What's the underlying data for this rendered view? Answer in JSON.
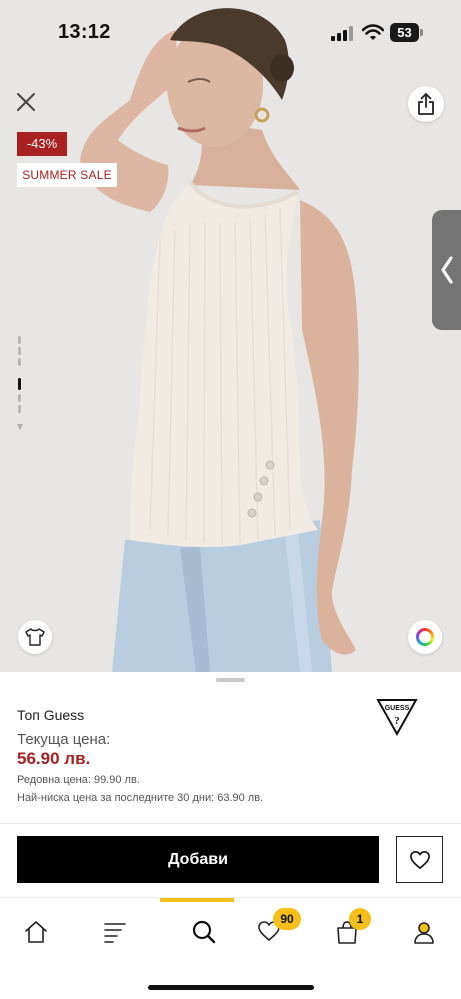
{
  "status_bar": {
    "time": "13:12",
    "battery": "53"
  },
  "gallery": {
    "discount_badge": "-43%",
    "sale_badge": "SUMMER SALE",
    "icons": {
      "close": "close-icon",
      "share": "share-icon",
      "back": "chevron-left-icon",
      "shirt": "tshirt-icon",
      "colors": "color-wheel-icon"
    }
  },
  "product": {
    "title": "Топ Guess",
    "brand_logo": "GUESS",
    "price_label": "Текуща цена:",
    "price": "56.90 лв.",
    "regular_price": "Редовна цена: 99.90 лв.",
    "lowest_price": "Най-ниска цена за последните 30 дни: 63.90 лв."
  },
  "actions": {
    "add_label": "Добави",
    "favorite_icon": "heart-icon"
  },
  "tabbar": {
    "items": [
      {
        "name": "home",
        "icon": "home-icon"
      },
      {
        "name": "menu",
        "icon": "menu-icon"
      },
      {
        "name": "search",
        "icon": "search-icon",
        "active": true
      },
      {
        "name": "favorites",
        "icon": "heart-icon",
        "count": "90"
      },
      {
        "name": "cart",
        "icon": "bag-icon",
        "count": "1"
      },
      {
        "name": "account",
        "icon": "user-icon"
      }
    ]
  },
  "colors": {
    "accent": "#f3c01a",
    "sale": "#a8201f",
    "button": "#000000"
  }
}
